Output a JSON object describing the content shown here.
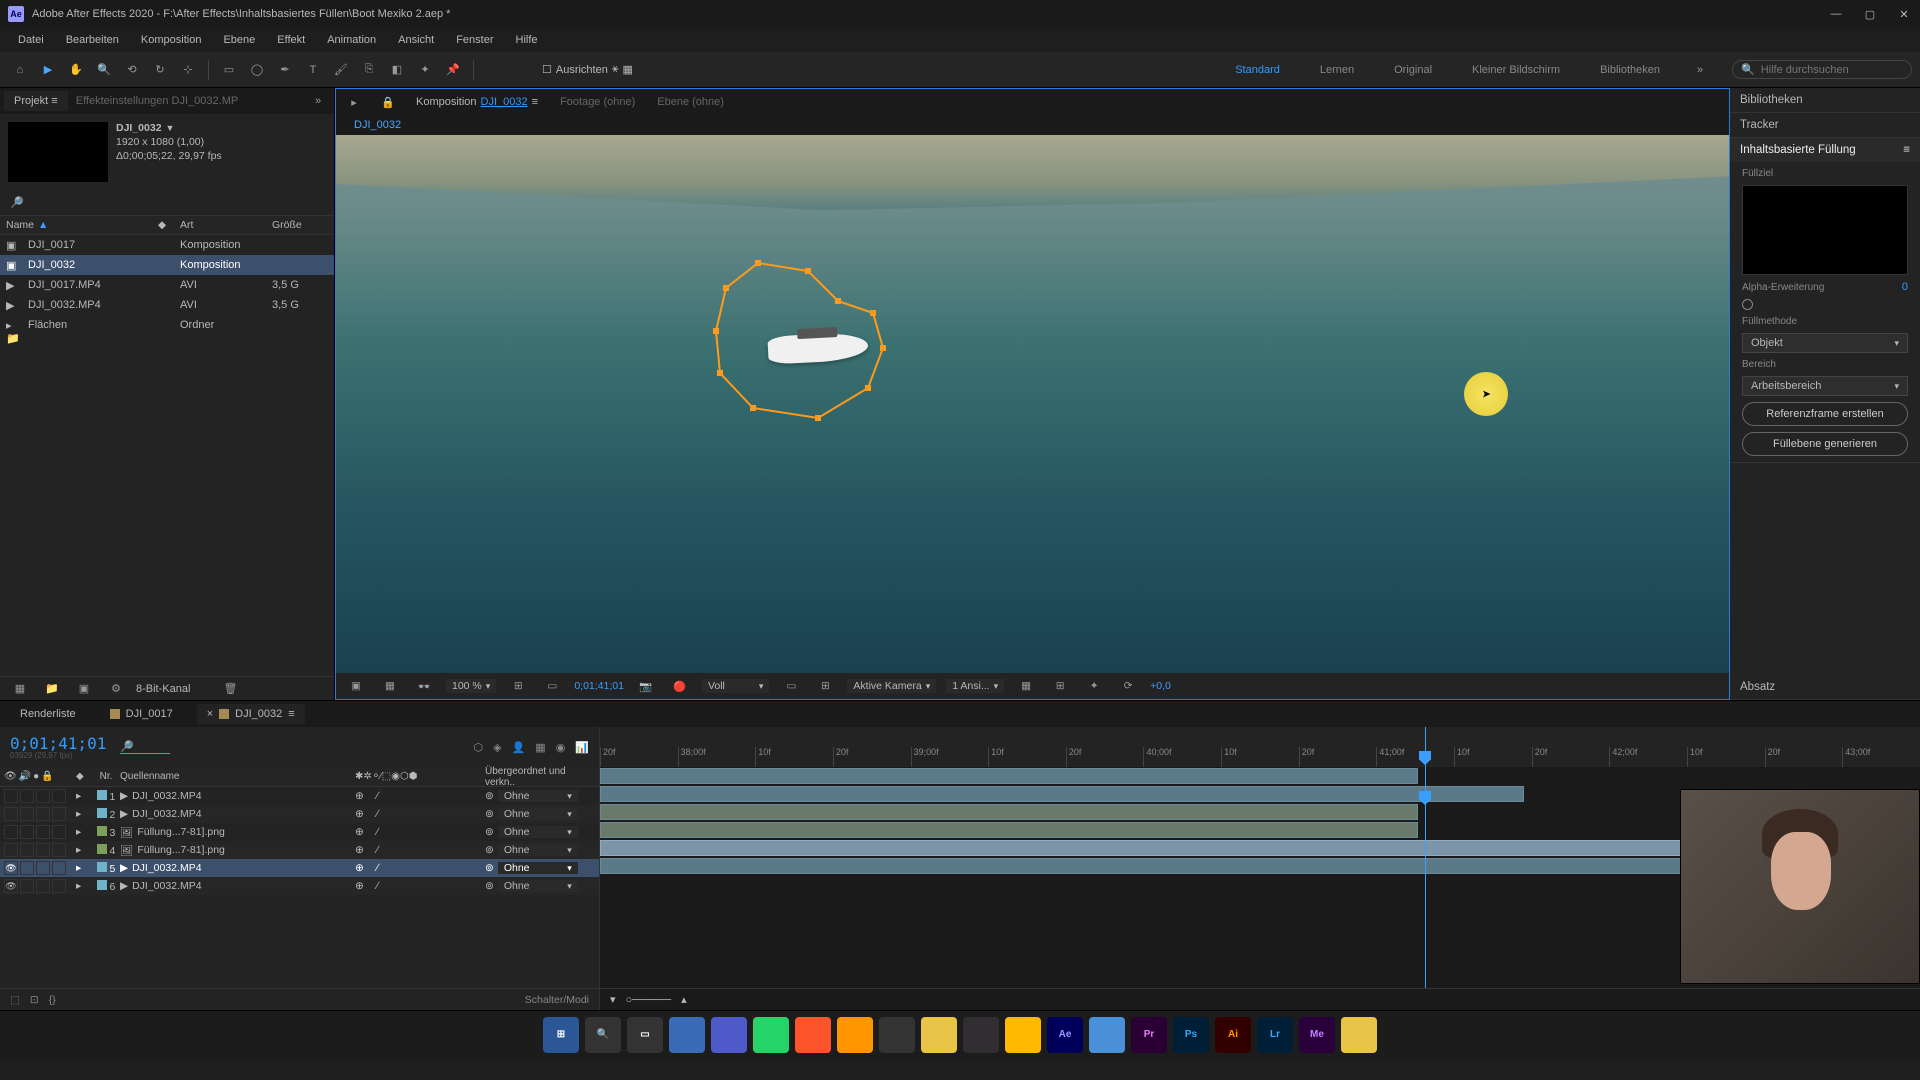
{
  "title": "Adobe After Effects 2020 - F:\\After Effects\\Inhaltsbasiertes Füllen\\Boot Mexiko 2.aep *",
  "menu": [
    "Datei",
    "Bearbeiten",
    "Komposition",
    "Ebene",
    "Effekt",
    "Animation",
    "Ansicht",
    "Fenster",
    "Hilfe"
  ],
  "toolbar": {
    "align_label": "Ausrichten",
    "workspaces": [
      "Standard",
      "Lernen",
      "Original",
      "Kleiner Bildschirm",
      "Bibliotheken"
    ],
    "active_workspace": "Standard",
    "search_placeholder": "Hilfe durchsuchen"
  },
  "project_panel": {
    "tab": "Projekt",
    "ghost_tab": "Effekteinstellungen  DJI_0032.MP",
    "asset_name": "DJI_0032",
    "asset_res": "1920 x 1080 (1,00)",
    "asset_dur": "Δ0;00;05;22, 29,97 fps",
    "columns": {
      "name": "Name",
      "type": "Art",
      "size": "Größe"
    },
    "rows": [
      {
        "name": "DJI_0017",
        "type": "Komposition",
        "size": "",
        "color": "#a58a52",
        "icon": "comp"
      },
      {
        "name": "DJI_0032",
        "type": "Komposition",
        "size": "",
        "color": "#a58a52",
        "icon": "comp",
        "selected": true
      },
      {
        "name": "DJI_0017.MP4",
        "type": "AVI",
        "size": "3,5 G",
        "color": "#6fb2c9",
        "icon": "video"
      },
      {
        "name": "DJI_0032.MP4",
        "type": "AVI",
        "size": "3,5 G",
        "color": "#6fb2c9",
        "icon": "video"
      },
      {
        "name": "Flächen",
        "type": "Ordner",
        "size": "",
        "color": "#e2c23a",
        "icon": "folder"
      }
    ],
    "footer_bpc": "8-Bit-Kanal"
  },
  "comp_panel": {
    "tab_prefix": "Komposition",
    "tab_name": "DJI_0032",
    "footage_tab": "Footage  (ohne)",
    "layer_tab": "Ebene  (ohne)",
    "breadcrumb": "DJI_0032",
    "footer": {
      "zoom": "100 %",
      "timecode": "0;01;41;01",
      "res": "Voll",
      "camera": "Aktive Kamera",
      "views": "1 Ansi...",
      "exposure": "+0,0"
    }
  },
  "right_panel": {
    "libraries": "Bibliotheken",
    "tracker": "Tracker",
    "caf_title": "Inhaltsbasierte Füllung",
    "fill_target": "Füllziel",
    "alpha_label": "Alpha-Erweiterung",
    "alpha_value": "0",
    "method_label": "Füllmethode",
    "method_value": "Objekt",
    "range_label": "Bereich",
    "range_value": "Arbeitsbereich",
    "btn_ref": "Referenzframe erstellen",
    "btn_gen": "Füllebene generieren",
    "paragraph": "Absatz"
  },
  "timeline": {
    "render_tab": "Renderliste",
    "comp1": "DJI_0017",
    "comp2": "DJI_0032",
    "timecode": "0;01;41;01",
    "timecode_sub": "03929 (29,97 fps)",
    "hdr_num": "Nr.",
    "hdr_name": "Quellenname",
    "hdr_parent": "Übergeordnet und verkn..",
    "parent_none": "Ohne",
    "switch_label": "Schalter/Modi",
    "ruler_ticks": [
      "20f",
      "38;00f",
      "10f",
      "20f",
      "39;00f",
      "10f",
      "20f",
      "40;00f",
      "10f",
      "20f",
      "41;00f",
      "10f",
      "20f",
      "42;00f",
      "10f",
      "20f",
      "43;00f"
    ],
    "layers": [
      {
        "num": "1",
        "name": "DJI_0032.MP4",
        "color": "#6fb2c9",
        "icon": "vid",
        "vis": false,
        "start": 0,
        "end": 62
      },
      {
        "num": "2",
        "name": "DJI_0032.MP4",
        "color": "#6fb2c9",
        "icon": "vid",
        "vis": false,
        "start": 0,
        "end": 70
      },
      {
        "num": "3",
        "name": "Füllung...7-81].png",
        "color": "#7aa05a",
        "icon": "png",
        "vis": false,
        "start": 0,
        "end": 62
      },
      {
        "num": "4",
        "name": "Füllung...7-81].png",
        "color": "#7aa05a",
        "icon": "png",
        "vis": false,
        "start": 0,
        "end": 62
      },
      {
        "num": "5",
        "name": "DJI_0032.MP4",
        "color": "#6fb2c9",
        "icon": "vid",
        "vis": true,
        "start": 0,
        "end": 100,
        "selected": true
      },
      {
        "num": "6",
        "name": "DJI_0032.MP4",
        "color": "#6fb2c9",
        "icon": "vid",
        "vis": true,
        "start": 0,
        "end": 100
      }
    ]
  },
  "taskbar": [
    {
      "name": "start",
      "bg": "#2b5797",
      "fg": "#fff",
      "txt": "⊞"
    },
    {
      "name": "search",
      "bg": "#333",
      "fg": "#fff",
      "txt": "🔍"
    },
    {
      "name": "taskview",
      "bg": "#333",
      "fg": "#fff",
      "txt": "▭"
    },
    {
      "name": "app1",
      "bg": "#3a6cb5",
      "fg": "#fff",
      "txt": ""
    },
    {
      "name": "teams",
      "bg": "#5059c9",
      "fg": "#fff",
      "txt": ""
    },
    {
      "name": "whatsapp",
      "bg": "#25d366",
      "fg": "#fff",
      "txt": ""
    },
    {
      "name": "brave",
      "bg": "#fb542b",
      "fg": "#fff",
      "txt": ""
    },
    {
      "name": "firefox",
      "bg": "#ff9500",
      "fg": "#fff",
      "txt": ""
    },
    {
      "name": "app2",
      "bg": "#333",
      "fg": "#fff",
      "txt": ""
    },
    {
      "name": "app3",
      "bg": "#e8c547",
      "fg": "#000",
      "txt": ""
    },
    {
      "name": "obs",
      "bg": "#302e31",
      "fg": "#fff",
      "txt": ""
    },
    {
      "name": "explorer",
      "bg": "#ffb900",
      "fg": "#000",
      "txt": ""
    },
    {
      "name": "ae",
      "bg": "#00005b",
      "fg": "#9999ff",
      "txt": "Ae"
    },
    {
      "name": "app4",
      "bg": "#4a90d9",
      "fg": "#fff",
      "txt": ""
    },
    {
      "name": "pr",
      "bg": "#2a0034",
      "fg": "#e879f9",
      "txt": "Pr"
    },
    {
      "name": "ps",
      "bg": "#001e36",
      "fg": "#31a8ff",
      "txt": "Ps"
    },
    {
      "name": "ai",
      "bg": "#330000",
      "fg": "#ff9a00",
      "txt": "Ai"
    },
    {
      "name": "lr",
      "bg": "#001e36",
      "fg": "#31a8ff",
      "txt": "Lr"
    },
    {
      "name": "me",
      "bg": "#2a003a",
      "fg": "#c080ff",
      "txt": "Me"
    },
    {
      "name": "app5",
      "bg": "#e8c547",
      "fg": "#000",
      "txt": ""
    }
  ]
}
